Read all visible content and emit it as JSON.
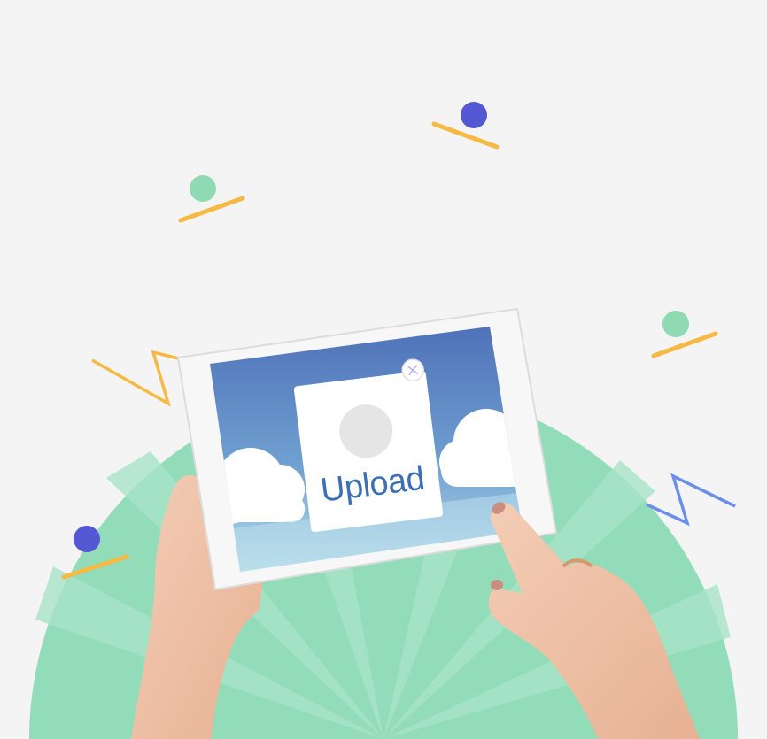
{
  "upload_card": {
    "label": "Upload"
  },
  "icons": {
    "close": "close-icon",
    "image_placeholder": "image-placeholder-icon"
  },
  "colors": {
    "background": "#f4f4f5",
    "burst_green": "#8fdcb7",
    "dot_indigo": "#5558d3",
    "dot_mint": "#8fd9b3",
    "dash_yellow": "#f5b944",
    "zigzag_blue": "#6b8fe8",
    "screen_sky_top": "#4f72b8",
    "screen_sky_bottom": "#a9d6e8",
    "upload_text": "#3d6fb5"
  }
}
